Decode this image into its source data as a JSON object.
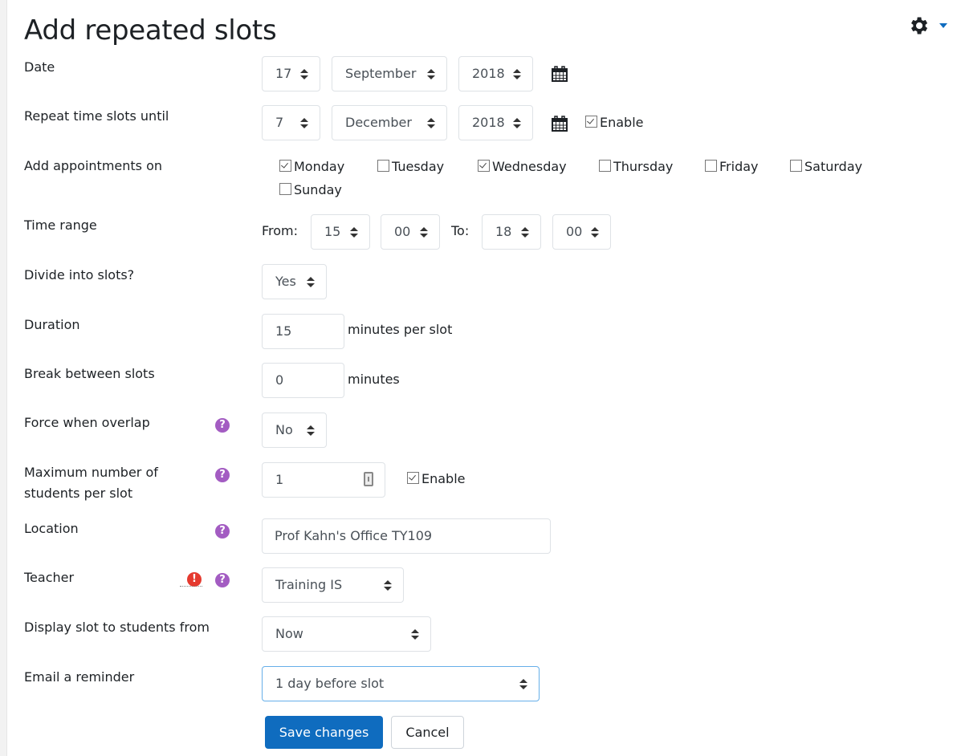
{
  "page": {
    "title": "Add repeated slots"
  },
  "header": {
    "settings_icon": "gear-icon",
    "menu_caret_icon": "caret-down-icon",
    "accent": "#0f6cbf"
  },
  "form": {
    "date": {
      "label": "Date",
      "day": "17",
      "month": "September",
      "year": "2018",
      "calendar_icon": "calendar-icon"
    },
    "repeat_until": {
      "label": "Repeat time slots until",
      "day": "7",
      "month": "December",
      "year": "2018",
      "calendar_icon": "calendar-icon",
      "enable_label": "Enable",
      "enabled": true
    },
    "add_appointments_on": {
      "label": "Add appointments on",
      "days": [
        {
          "label": "Monday",
          "checked": true
        },
        {
          "label": "Tuesday",
          "checked": false
        },
        {
          "label": "Wednesday",
          "checked": true
        },
        {
          "label": "Thursday",
          "checked": false
        },
        {
          "label": "Friday",
          "checked": false
        },
        {
          "label": "Saturday",
          "checked": false
        },
        {
          "label": "Sunday",
          "checked": false
        }
      ]
    },
    "time_range": {
      "label": "Time range",
      "from_label": "From:",
      "from_hour": "15",
      "from_minute": "00",
      "to_label": "To:",
      "to_hour": "18",
      "to_minute": "00"
    },
    "divide_into_slots": {
      "label": "Divide into slots?",
      "value": "Yes"
    },
    "duration": {
      "label": "Duration",
      "value": "15",
      "suffix": "minutes per slot"
    },
    "break_between": {
      "label": "Break between slots",
      "value": "0",
      "suffix": "minutes"
    },
    "force_overlap": {
      "label": "Force when overlap",
      "value": "No",
      "help_icon": "help-icon"
    },
    "max_students": {
      "label_line1": "Maximum number of",
      "label_line2": "students per slot",
      "value": "1",
      "enable_label": "Enable",
      "enabled": true,
      "help_icon": "help-icon"
    },
    "location": {
      "label": "Location",
      "value": "Prof Kahn's Office TY109",
      "help_icon": "help-icon"
    },
    "teacher": {
      "label": "Teacher",
      "value": "Training IS",
      "required_icon": "required-icon",
      "help_icon": "help-icon"
    },
    "display_from": {
      "label": "Display slot to students from",
      "value": "Now"
    },
    "email_reminder": {
      "label": "Email a reminder",
      "value": "1 day before slot"
    }
  },
  "buttons": {
    "save": "Save changes",
    "cancel": "Cancel"
  },
  "colors": {
    "help": "#a35cc2",
    "required": "#e53a2f",
    "primary": "#0f6cbf"
  }
}
